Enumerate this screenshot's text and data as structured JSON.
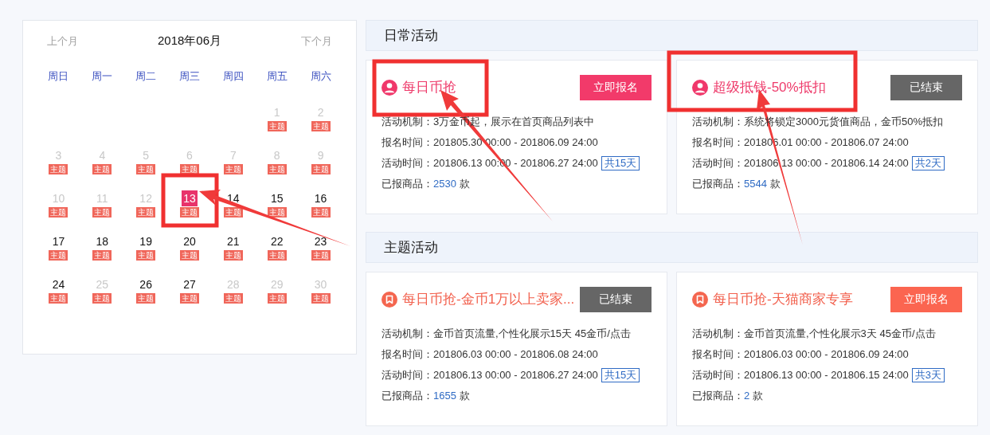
{
  "calendar": {
    "prev": "上个月",
    "title": "2018年06月",
    "next": "下个月",
    "weekdays": [
      "周日",
      "周一",
      "周二",
      "周三",
      "周四",
      "周五",
      "周六"
    ],
    "weeks": [
      {
        "starts_mid_week": true,
        "days": [
          {
            "day": "1",
            "muted": true,
            "selected": false,
            "badge": "主题"
          },
          {
            "day": "2",
            "muted": true,
            "selected": false,
            "badge": "主题"
          }
        ]
      },
      {
        "days": [
          {
            "day": "3",
            "muted": true,
            "selected": false,
            "badge": "主题"
          },
          {
            "day": "4",
            "muted": true,
            "selected": false,
            "badge": "主题"
          },
          {
            "day": "5",
            "muted": true,
            "selected": false,
            "badge": "主题"
          },
          {
            "day": "6",
            "muted": true,
            "selected": false,
            "badge": "主题"
          },
          {
            "day": "7",
            "muted": true,
            "selected": false,
            "badge": "主题"
          },
          {
            "day": "8",
            "muted": true,
            "selected": false,
            "badge": "主题"
          },
          {
            "day": "9",
            "muted": true,
            "selected": false,
            "badge": "主题"
          }
        ]
      },
      {
        "days": [
          {
            "day": "10",
            "muted": true,
            "selected": false,
            "badge": "主题"
          },
          {
            "day": "11",
            "muted": true,
            "selected": false,
            "badge": "主题"
          },
          {
            "day": "12",
            "muted": true,
            "selected": false,
            "badge": "主题"
          },
          {
            "day": "13",
            "muted": false,
            "selected": true,
            "badge": "主题"
          },
          {
            "day": "14",
            "muted": false,
            "selected": false,
            "badge": "主题"
          },
          {
            "day": "15",
            "muted": false,
            "selected": false,
            "badge": "主题"
          },
          {
            "day": "16",
            "muted": false,
            "selected": false,
            "badge": "主题"
          }
        ]
      },
      {
        "days": [
          {
            "day": "17",
            "muted": false,
            "selected": false,
            "badge": "主题"
          },
          {
            "day": "18",
            "muted": false,
            "selected": false,
            "badge": "主题"
          },
          {
            "day": "19",
            "muted": false,
            "selected": false,
            "badge": "主题"
          },
          {
            "day": "20",
            "muted": false,
            "selected": false,
            "badge": "主题"
          },
          {
            "day": "21",
            "muted": false,
            "selected": false,
            "badge": "主题"
          },
          {
            "day": "22",
            "muted": false,
            "selected": false,
            "badge": "主题"
          },
          {
            "day": "23",
            "muted": false,
            "selected": false,
            "badge": "主题"
          }
        ]
      },
      {
        "days": [
          {
            "day": "24",
            "muted": false,
            "selected": false,
            "badge": "主题"
          },
          {
            "day": "25",
            "muted": true,
            "selected": false,
            "badge": "主题"
          },
          {
            "day": "26",
            "muted": false,
            "selected": false,
            "badge": "主题"
          },
          {
            "day": "27",
            "muted": false,
            "selected": false,
            "badge": "主题"
          },
          {
            "day": "28",
            "muted": true,
            "selected": false,
            "badge": "主题"
          },
          {
            "day": "29",
            "muted": true,
            "selected": false,
            "badge": "主题"
          },
          {
            "day": "30",
            "muted": true,
            "selected": false,
            "badge": "主题"
          }
        ]
      }
    ]
  },
  "sections": [
    {
      "title": "日常活动",
      "kind": "daily",
      "cards": [
        {
          "title": "每日币抢",
          "button": {
            "label": "立即报名",
            "ended": false
          },
          "mechanism": {
            "label": "活动机制：",
            "value": "3万金币起，展示在首页商品列表中"
          },
          "signup_time": {
            "label": "报名时间：",
            "value": "201805.30 00:00 - 201806.09 24:00"
          },
          "activity_time": {
            "label": "活动时间：",
            "value": "201806.13 00:00 - 201806.27 24:00",
            "duration": "共15天"
          },
          "registered": {
            "label": "已报商品：",
            "count": "2530",
            "unit": "款"
          }
        },
        {
          "title": "超级抵钱-50%抵扣",
          "button": {
            "label": "已结束",
            "ended": true
          },
          "mechanism": {
            "label": "活动机制：",
            "value": "系统将锁定3000元货值商品，金币50%抵扣"
          },
          "signup_time": {
            "label": "报名时间：",
            "value": "201806.01 00:00 - 201806.07 24:00"
          },
          "activity_time": {
            "label": "活动时间：",
            "value": "201806.13 00:00 - 201806.14 24:00",
            "duration": "共2天"
          },
          "registered": {
            "label": "已报商品：",
            "count": "5544",
            "unit": "款"
          }
        }
      ]
    },
    {
      "title": "主题活动",
      "kind": "theme",
      "cards": [
        {
          "title": "每日币抢-金币1万以上卖家...",
          "button": {
            "label": "已结束",
            "ended": true
          },
          "mechanism": {
            "label": "活动机制：",
            "value": "金币首页流量,个性化展示15天 45金币/点击"
          },
          "signup_time": {
            "label": "报名时间：",
            "value": "201806.03 00:00 - 201806.08 24:00"
          },
          "activity_time": {
            "label": "活动时间：",
            "value": "201806.13 00:00 - 201806.27 24:00",
            "duration": "共15天"
          },
          "registered": {
            "label": "已报商品：",
            "count": "1655",
            "unit": "款"
          }
        },
        {
          "title": "每日币抢-天猫商家专享",
          "button": {
            "label": "立即报名",
            "ended": false
          },
          "mechanism": {
            "label": "活动机制：",
            "value": "金币首页流量,个性化展示3天 45金币/点击"
          },
          "signup_time": {
            "label": "报名时间：",
            "value": "201806.03 00:00 - 201806.09 24:00"
          },
          "activity_time": {
            "label": "活动时间：",
            "value": "201806.13 00:00 - 201806.15 24:00",
            "duration": "共3天"
          },
          "registered": {
            "label": "已报商品：",
            "count": "2",
            "unit": "款"
          }
        }
      ]
    }
  ]
}
